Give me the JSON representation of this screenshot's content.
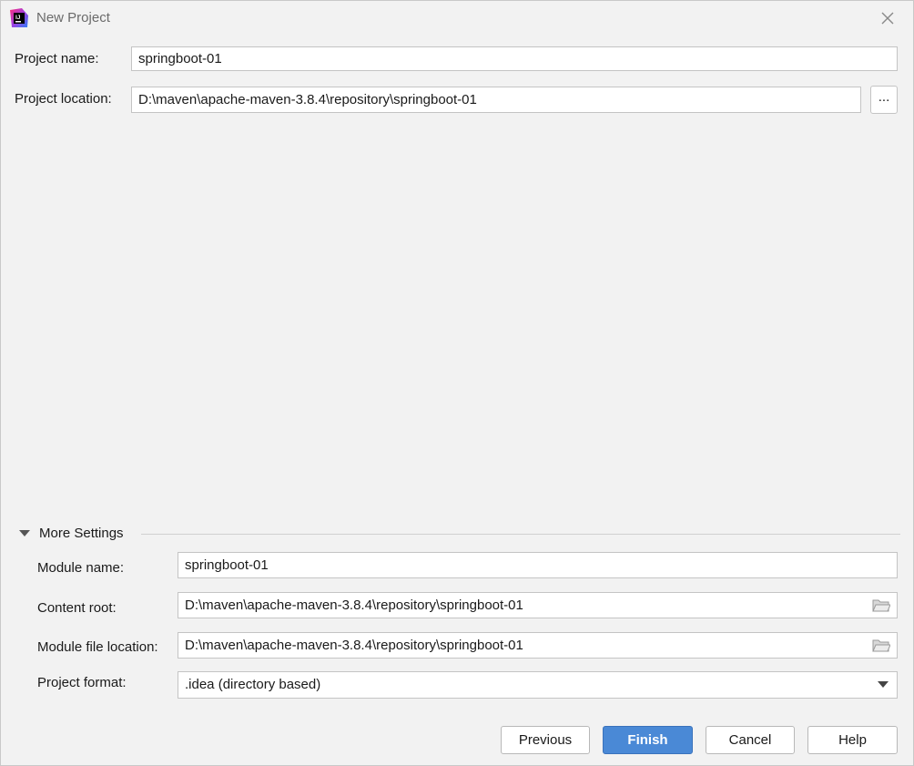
{
  "window": {
    "title": "New Project",
    "icon": "intellij-idea-icon"
  },
  "project": {
    "name_label": "Project name:",
    "name_value": "springboot-01",
    "location_label": "Project location:",
    "location_value": "D:\\maven\\apache-maven-3.8.4\\repository\\springboot-01",
    "browse_label": "..."
  },
  "more_settings": {
    "title": "More Settings",
    "expanded": true,
    "module_name_label": "Module name:",
    "module_name_value": "springboot-01",
    "content_root_label": "Content root:",
    "content_root_value": "D:\\maven\\apache-maven-3.8.4\\repository\\springboot-01",
    "module_file_label": "Module file location:",
    "module_file_value": "D:\\maven\\apache-maven-3.8.4\\repository\\springboot-01",
    "format_label": "Project format:",
    "format_value": ".idea (directory based)"
  },
  "buttons": {
    "previous": "Previous",
    "finish": "Finish",
    "cancel": "Cancel",
    "help": "Help"
  },
  "colors": {
    "primary_button": "#4a89d6",
    "background": "#f2f2f2"
  }
}
